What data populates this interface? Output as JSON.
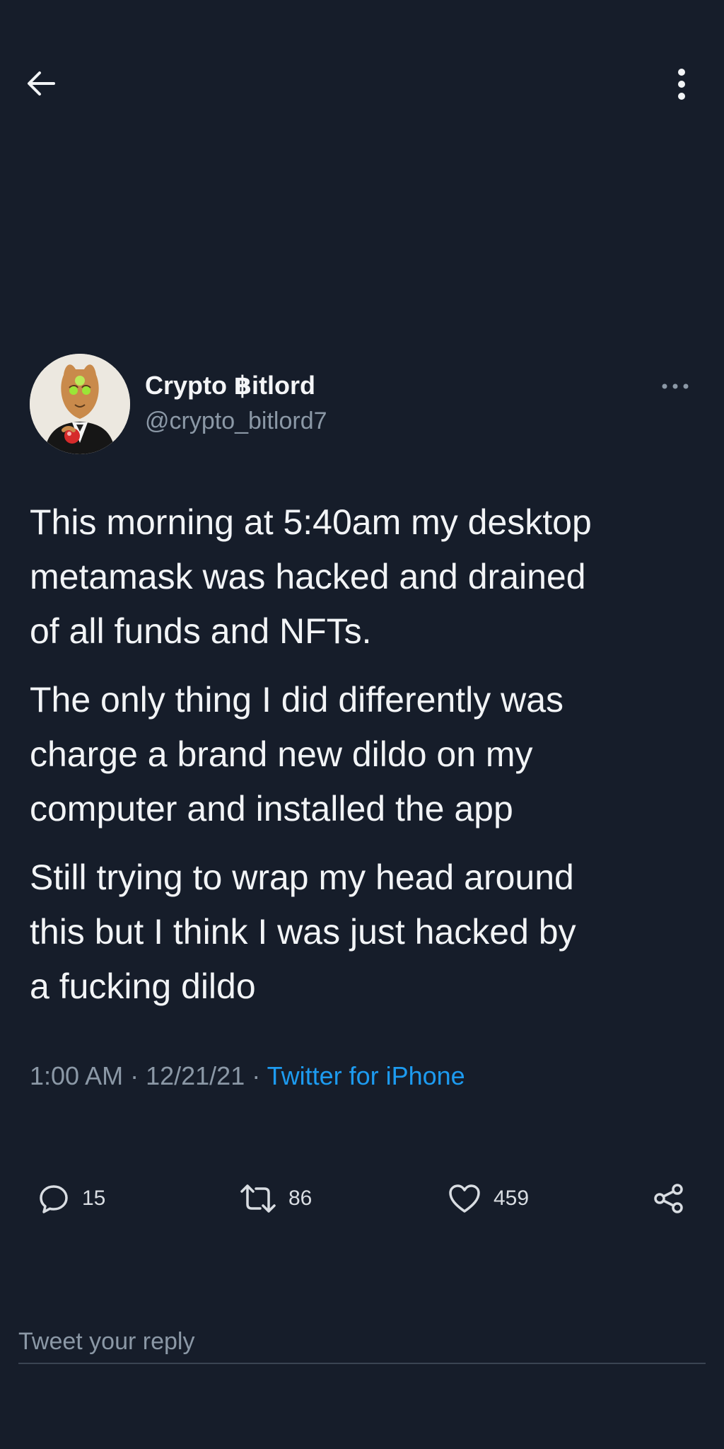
{
  "colors": {
    "background": "#161d2a",
    "text_primary": "#f2f4f6",
    "text_secondary": "#8b98a6",
    "link": "#1d9bf0",
    "divider": "#3a4452"
  },
  "topbar": {
    "back_icon": "arrow-left-icon",
    "more_icon": "vertical-dots-icon"
  },
  "tweet": {
    "author": {
      "display_name": "Crypto ฿itlord",
      "handle": "@crypto_bitlord7"
    },
    "more_icon": "horizontal-dots-icon",
    "paragraphs": [
      "This morning at 5:40am my desktop\nmetamask was hacked and drained\nof all funds and NFTs.",
      "The only thing I did differently was\ncharge a brand new dildo on my\ncomputer and installed the app",
      "Still trying to wrap my head around\nthis but I think I was just hacked by\na fucking dildo"
    ],
    "time": "1:00 AM",
    "date": "12/21/21",
    "source": "Twitter for iPhone"
  },
  "actions": {
    "reply": {
      "icon": "reply-bubble-icon",
      "count": "15"
    },
    "retweet": {
      "icon": "retweet-icon",
      "count": "86"
    },
    "like": {
      "icon": "heart-icon",
      "count": "459"
    },
    "share": {
      "icon": "share-icon"
    }
  },
  "reply_box": {
    "placeholder": "Tweet your reply"
  }
}
